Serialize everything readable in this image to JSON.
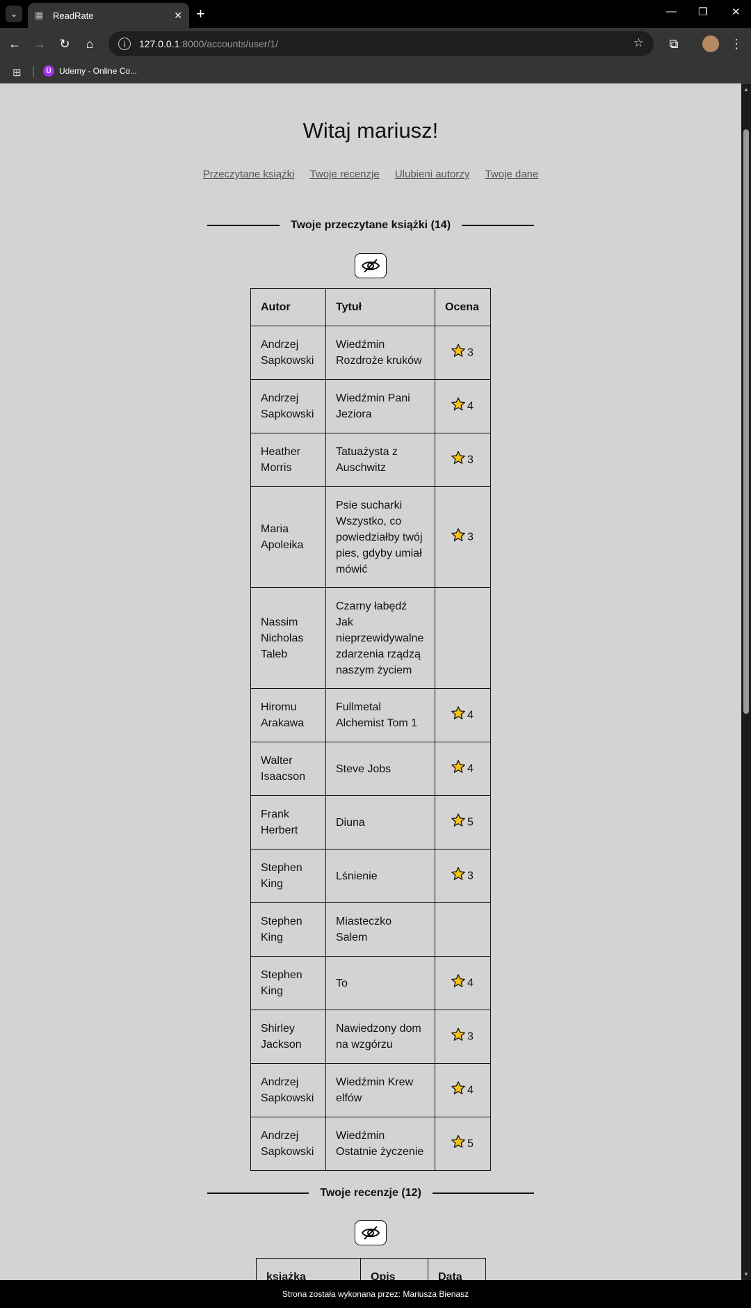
{
  "browser": {
    "tab_title": "ReadRate",
    "url_host": "127.0.0.1",
    "url_rest": ":8000/accounts/user/1/",
    "bookmark_label": "Udemy - Online Co..."
  },
  "page": {
    "welcome": "Witaj mariusz!",
    "nav": {
      "read": "Przeczytane książki",
      "reviews": "Twoje recenzje",
      "authors": "Ulubieni autorzy",
      "data": "Twoje dane"
    },
    "read_section_title": "Twoje przeczytane książki (14)",
    "reviews_section_title": "Twoje recenzje (12)",
    "books_table": {
      "headers": {
        "author": "Autor",
        "title": "Tytuł",
        "rating": "Ocena"
      },
      "rows": [
        {
          "author": "Andrzej Sapkowski",
          "title": "Wiedźmin Rozdroże kruków",
          "rating": "3"
        },
        {
          "author": "Andrzej Sapkowski",
          "title": "Wiedźmin Pani Jeziora",
          "rating": "4"
        },
        {
          "author": "Heather Morris",
          "title": "Tatuażysta z Auschwitz",
          "rating": "3"
        },
        {
          "author": "Maria Apoleika",
          "title": "Psie sucharki Wszystko, co powiedziałby twój pies, gdyby umiał mówić",
          "rating": "3"
        },
        {
          "author": "Nassim Nicholas Taleb",
          "title": "Czarny łabędź Jak nieprzewidywalne zdarzenia rządzą naszym życiem",
          "rating": ""
        },
        {
          "author": "Hiromu Arakawa",
          "title": "Fullmetal Alchemist Tom 1",
          "rating": "4"
        },
        {
          "author": "Walter Isaacson",
          "title": "Steve Jobs",
          "rating": "4"
        },
        {
          "author": "Frank Herbert",
          "title": "Diuna",
          "rating": "5"
        },
        {
          "author": "Stephen King",
          "title": "Lśnienie",
          "rating": "3"
        },
        {
          "author": "Stephen King",
          "title": "Miasteczko Salem",
          "rating": ""
        },
        {
          "author": "Stephen King",
          "title": "To",
          "rating": "4"
        },
        {
          "author": "Shirley Jackson",
          "title": "Nawiedzony dom na wzgórzu",
          "rating": "3"
        },
        {
          "author": "Andrzej Sapkowski",
          "title": "Wiedźmin Krew elfów",
          "rating": "4"
        },
        {
          "author": "Andrzej Sapkowski",
          "title": "Wiedźmin Ostatnie życzenie",
          "rating": "5"
        }
      ]
    },
    "reviews_table": {
      "headers": {
        "book": "książka",
        "desc": "Opis",
        "date": "Data"
      }
    },
    "footer": "Strona została wykonana przez: Mariusza Bienasz"
  },
  "icons": {
    "star": "star-icon",
    "toggle": "eye-slash-icon",
    "star_fill": "#f7c21b"
  }
}
